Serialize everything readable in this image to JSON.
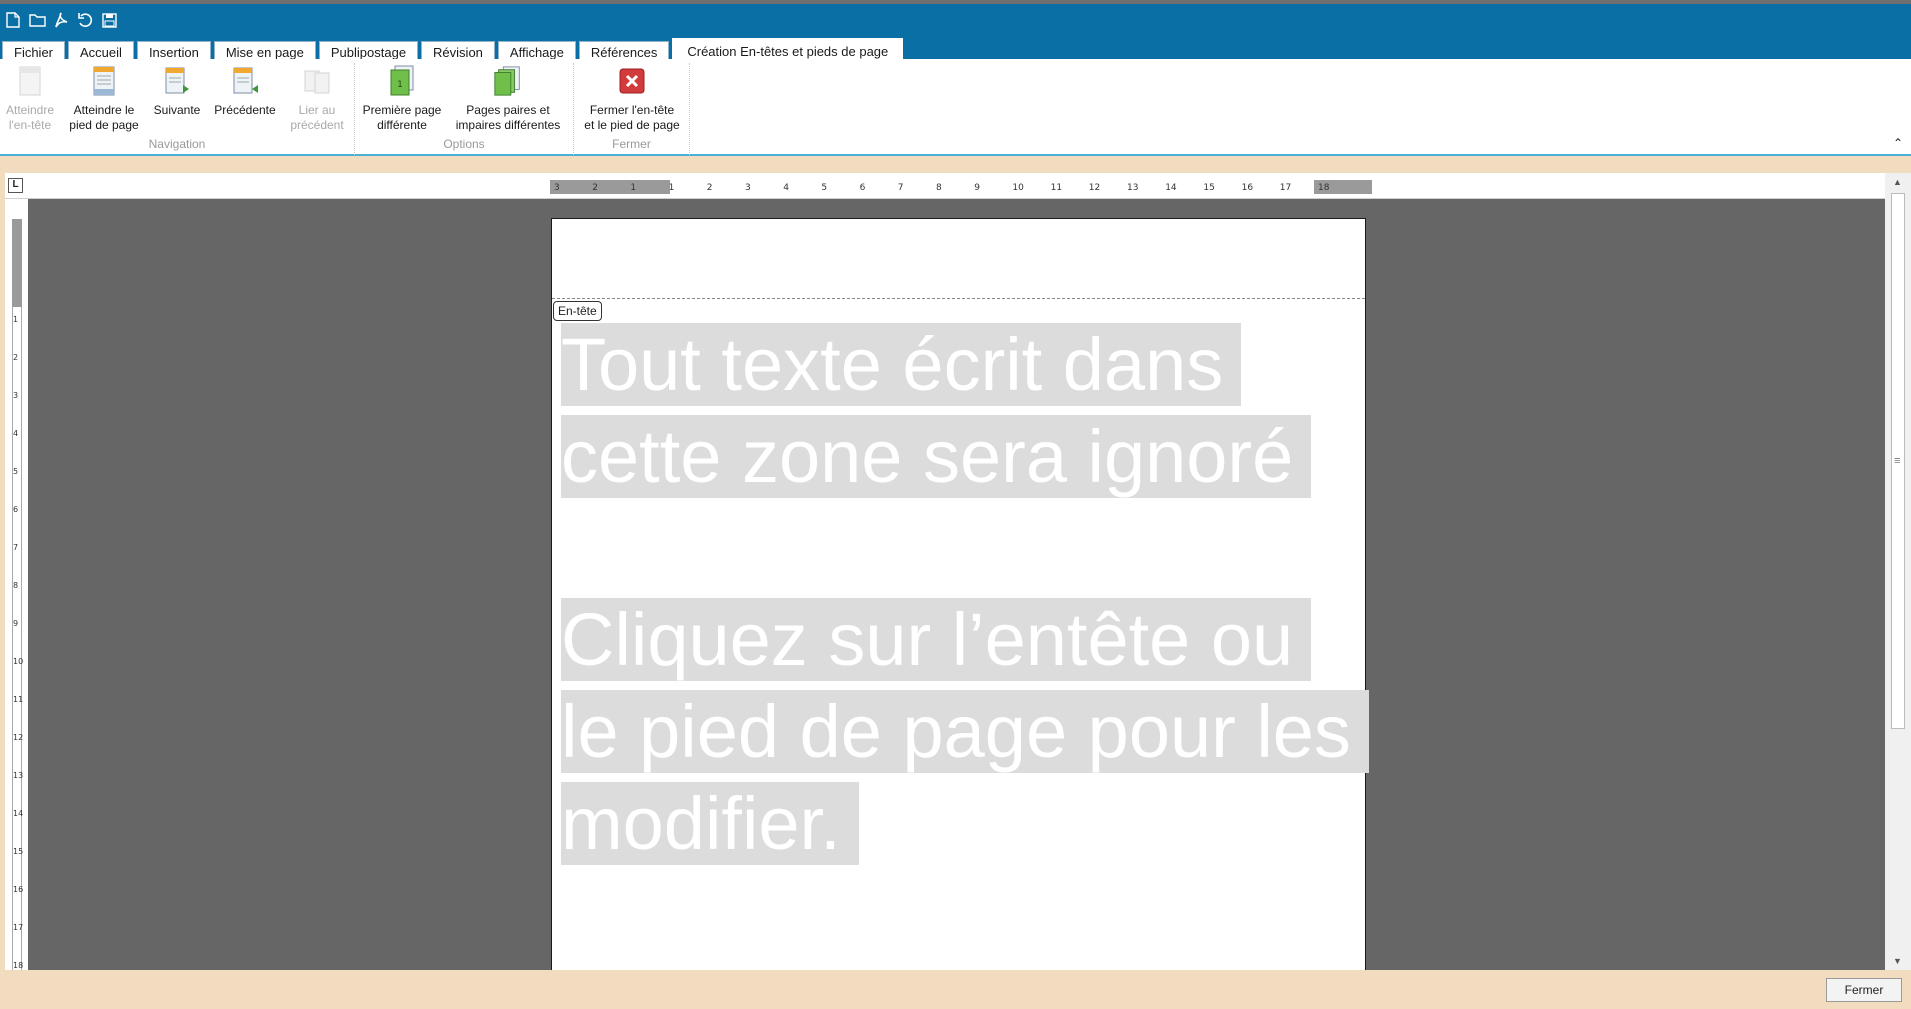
{
  "quick_access": [
    {
      "name": "new-document-icon"
    },
    {
      "name": "open-folder-icon"
    },
    {
      "name": "pdf-export-icon"
    },
    {
      "name": "undo-icon"
    },
    {
      "name": "save-icon"
    }
  ],
  "tabs": [
    {
      "label": "Fichier"
    },
    {
      "label": "Accueil"
    },
    {
      "label": "Insertion"
    },
    {
      "label": "Mise en page"
    },
    {
      "label": "Publipostage"
    },
    {
      "label": "Révision"
    },
    {
      "label": "Affichage"
    },
    {
      "label": "Références"
    },
    {
      "label": "Création En-têtes et pieds de page",
      "active": true
    }
  ],
  "ribbon": {
    "navigation": {
      "label": "Navigation",
      "goto_header": [
        "Atteindre",
        "l'en-tête"
      ],
      "goto_footer": [
        "Atteindre le",
        "pied de page"
      ],
      "next": "Suivante",
      "previous": "Précédente",
      "link_previous": [
        "Lier au",
        "précédent"
      ]
    },
    "options": {
      "label": "Options",
      "first_page": [
        "Première page",
        "différente"
      ],
      "odd_even": [
        "Pages paires et",
        "impaires différentes"
      ]
    },
    "close": {
      "label": "Fermer",
      "close_header": [
        "Fermer l'en-tête",
        "et le pied de page"
      ]
    }
  },
  "ruler": {
    "corner": "L",
    "ticks": [
      "3",
      "2",
      "1",
      "1",
      "2",
      "3",
      "4",
      "5",
      "6",
      "7",
      "8",
      "9",
      "10",
      "11",
      "12",
      "13",
      "14",
      "15",
      "16",
      "17",
      "18"
    ],
    "vticks": [
      "1",
      "2",
      "3",
      "4",
      "5",
      "6",
      "7",
      "8",
      "9",
      "10",
      "11",
      "12",
      "13",
      "14",
      "15",
      "16",
      "17",
      "18"
    ]
  },
  "page": {
    "header_tag": "En-tête",
    "placeholder_1": "Tout texte écrit dans cette zone sera ignoré",
    "placeholder_2": "Cliquez sur l’entête ou le pied de page pour les modifier."
  },
  "footer": {
    "close_button": "Fermer"
  },
  "colors": {
    "title_bar": "#0a6fa5",
    "ribbon_accent": "#49b0d8",
    "background": "#f2dcbf",
    "canvas": "#666666",
    "close_icon": "#d23b3b"
  }
}
